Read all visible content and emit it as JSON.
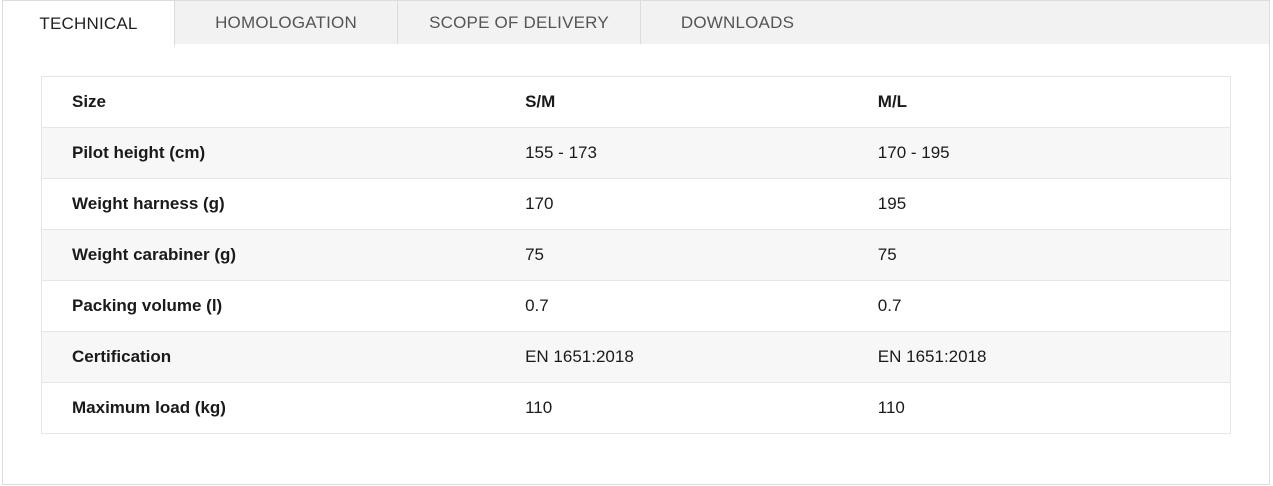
{
  "tabs": [
    {
      "label": "TECHNICAL",
      "active": true
    },
    {
      "label": "HOMOLOGATION",
      "active": false
    },
    {
      "label": "SCOPE OF DELIVERY",
      "active": false
    },
    {
      "label": "DOWNLOADS",
      "active": false
    }
  ],
  "table": {
    "header": [
      "Size",
      "S/M",
      "M/L"
    ],
    "rows": [
      [
        "Pilot height (cm)",
        "155 - 173",
        "170 - 195"
      ],
      [
        "Weight harness (g)",
        "170",
        "195"
      ],
      [
        "Weight carabiner (g)",
        "75",
        "75"
      ],
      [
        "Packing volume (l)",
        "0.7",
        "0.7"
      ],
      [
        "Certification",
        "EN 1651:2018",
        "EN 1651:2018"
      ],
      [
        "Maximum load (kg)",
        "110",
        "110"
      ]
    ]
  }
}
